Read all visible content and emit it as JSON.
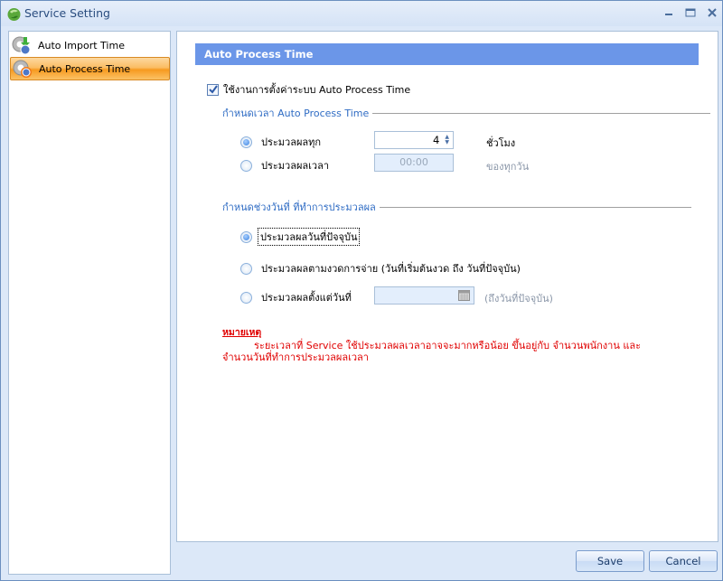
{
  "window": {
    "title": "Service Setting",
    "controls": {
      "minimize": "minimize",
      "maximize": "maximize",
      "close": "close"
    }
  },
  "nav": {
    "items": [
      {
        "label": "Auto Import Time",
        "icon": "gear-import-icon",
        "selected": false
      },
      {
        "label": "Auto Process Time",
        "icon": "gear-process-icon",
        "selected": true
      }
    ]
  },
  "panel": {
    "header": "Auto Process Time",
    "enable_checkbox": {
      "label": "ใช้งานการตั้งค่าระบบ Auto Process Time",
      "checked": true
    },
    "time_group": {
      "title": "กำหนดเวลา Auto Process Time",
      "every": {
        "label": "ประมวลผลทุก",
        "selected": true,
        "value": "4",
        "unit": "ชั่วโมง"
      },
      "at_time": {
        "label": "ประมวลผลเวลา",
        "selected": false,
        "value": "00:00",
        "unit": "ของทุกวัน"
      }
    },
    "date_group": {
      "title": "กำหนดช่วงวันที่ ที่ทำการประมวลผล",
      "options": [
        {
          "label": "ประมวลผลวันที่ปัจจุบัน",
          "selected": true
        },
        {
          "label": "ประมวลผลตามงวดการจ่าย (วันที่เริ่มต้นงวด ถึง วันที่ปัจจุบัน)",
          "selected": false
        },
        {
          "label": "ประมวลผลตั้งแต่วันที่",
          "selected": false,
          "date_value": "",
          "suffix": "(ถึงวันที่ปัจจุบัน)"
        }
      ]
    },
    "note": {
      "title": "หมายเหตุ",
      "body": "ระยะเวลาที่ Service ใช้ประมวลผลเวลาอาจจะมากหรือน้อย ขึ้นอยู่กับ จำนวนพนักงาน และจำนวนวันที่ทำการประมวลผลเวลา"
    }
  },
  "footer": {
    "save_label": "Save",
    "cancel_label": "Cancel"
  }
}
